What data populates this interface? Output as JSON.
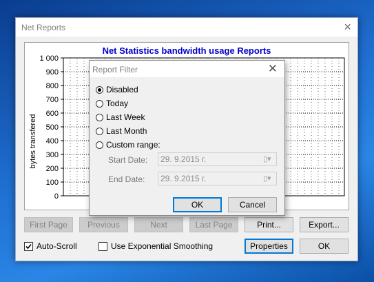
{
  "window": {
    "title": "Net Reports",
    "close_icon": "×"
  },
  "chart": {
    "title": "Net Statistics bandwidth usage Reports",
    "title_color": "#0000cc"
  },
  "chart_data": {
    "type": "bar",
    "title": "Net Statistics bandwidth usage Reports",
    "ylabel": "bytes transfered",
    "xlabel": "",
    "ylim": [
      0,
      1000
    ],
    "yticks": [
      "0",
      "100",
      "200",
      "300",
      "400",
      "500",
      "600",
      "700",
      "800",
      "900",
      "1 000"
    ],
    "categories": [],
    "values": [],
    "grid": true
  },
  "buttons": {
    "first_page": "First Page",
    "previous": "Previous",
    "next": "Next",
    "last_page": "Last Page",
    "print": "Print...",
    "export": "Export...",
    "properties": "Properties",
    "ok": "OK"
  },
  "options": {
    "auto_scroll": {
      "label": "Auto-Scroll",
      "checked": true
    },
    "exp_smoothing": {
      "label": "Use Exponential Smoothing",
      "checked": false
    }
  },
  "dialog": {
    "title": "Report Filter",
    "close_icon": "✕",
    "radios": [
      {
        "label": "Disabled",
        "selected": true
      },
      {
        "label": "Today",
        "selected": false
      },
      {
        "label": "Last Week",
        "selected": false
      },
      {
        "label": "Last Month",
        "selected": false
      },
      {
        "label": "Custom range:",
        "selected": false
      }
    ],
    "start_label": "Start Date:",
    "start_value": "29.  9.2015 г.",
    "end_label": "End Date:",
    "end_value": "29.  9.2015 г.",
    "ok": "OK",
    "cancel": "Cancel"
  }
}
